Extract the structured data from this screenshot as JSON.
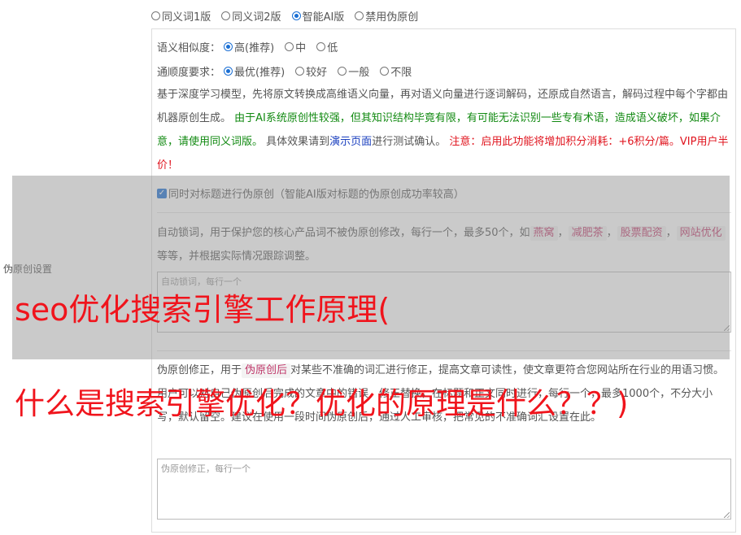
{
  "mode_options": [
    {
      "label": "同义词1版",
      "checked": false
    },
    {
      "label": "同义词2版",
      "checked": false
    },
    {
      "label": "智能AI版",
      "checked": true
    },
    {
      "label": "禁用伪原创",
      "checked": false
    }
  ],
  "similarity": {
    "label": "语义相似度：",
    "options": [
      {
        "label": "高(推荐)",
        "checked": true
      },
      {
        "label": "中",
        "checked": false
      },
      {
        "label": "低",
        "checked": false
      }
    ]
  },
  "fluency": {
    "label": "通顺度要求：",
    "options": [
      {
        "label": "最优(推荐)",
        "checked": true
      },
      {
        "label": "较好",
        "checked": false
      },
      {
        "label": "一般",
        "checked": false
      },
      {
        "label": "不限",
        "checked": false
      }
    ]
  },
  "description": {
    "part1": "基于深度学习模型，先将原文转换成高维语义向量，再对语义向量进行逐词解码，还原成自然语言，解码过程中每个字都由机器原创生成。",
    "part2_green": "由于AI系统原创性较强，但其知识结构毕竟有限，有可能无法识别一些专有术语，造成语义破坏，如果介意，请使用同义词版。",
    "part3": "具体效果请到",
    "link": "演示页面",
    "part4": "进行测试确认。",
    "part5_red": "注意：启用此功能将增加积分消耗：+6积分/篇。VIP用户半价！"
  },
  "title_checkbox": {
    "label": "同时对标题进行伪原创（智能AI版对标题的伪原创成功率较高）",
    "checked": true
  },
  "lock_words": {
    "intro": "自动锁词，用于保护您的核心产品词不被伪原创修改，每行一个，最多50个，如",
    "tags": [
      "燕窝",
      "减肥茶",
      "股票配资",
      "网站优化"
    ],
    "sep": "，",
    "outro": "等等，并根据实际情况跟踪调整。",
    "placeholder": "自动锁词，每行一个"
  },
  "side_label": "伪原创设置",
  "correction": {
    "intro": "伪原创修正，用于",
    "tag": "伪原创后",
    "text": "对某些不准确的词汇进行修正，提高文章可读性，使文章更符合您网站所在行业的用语习惯。用户可以对自己伪原创后完成的文章中的错误，修正替换，在标题和正文同时进行，每行一个，最多1000个，不分大小写，默认留空。建议在使用一段时间伪原创后，通过人工审核，把常见的不准确词汇设置在此。",
    "placeholder": "伪原创修正，每行一个"
  },
  "watermark": {
    "line1": "seo优化搜索引擎工作原理(",
    "line2": "什么是搜索引擎优化？优化的原理是什么？？)"
  }
}
